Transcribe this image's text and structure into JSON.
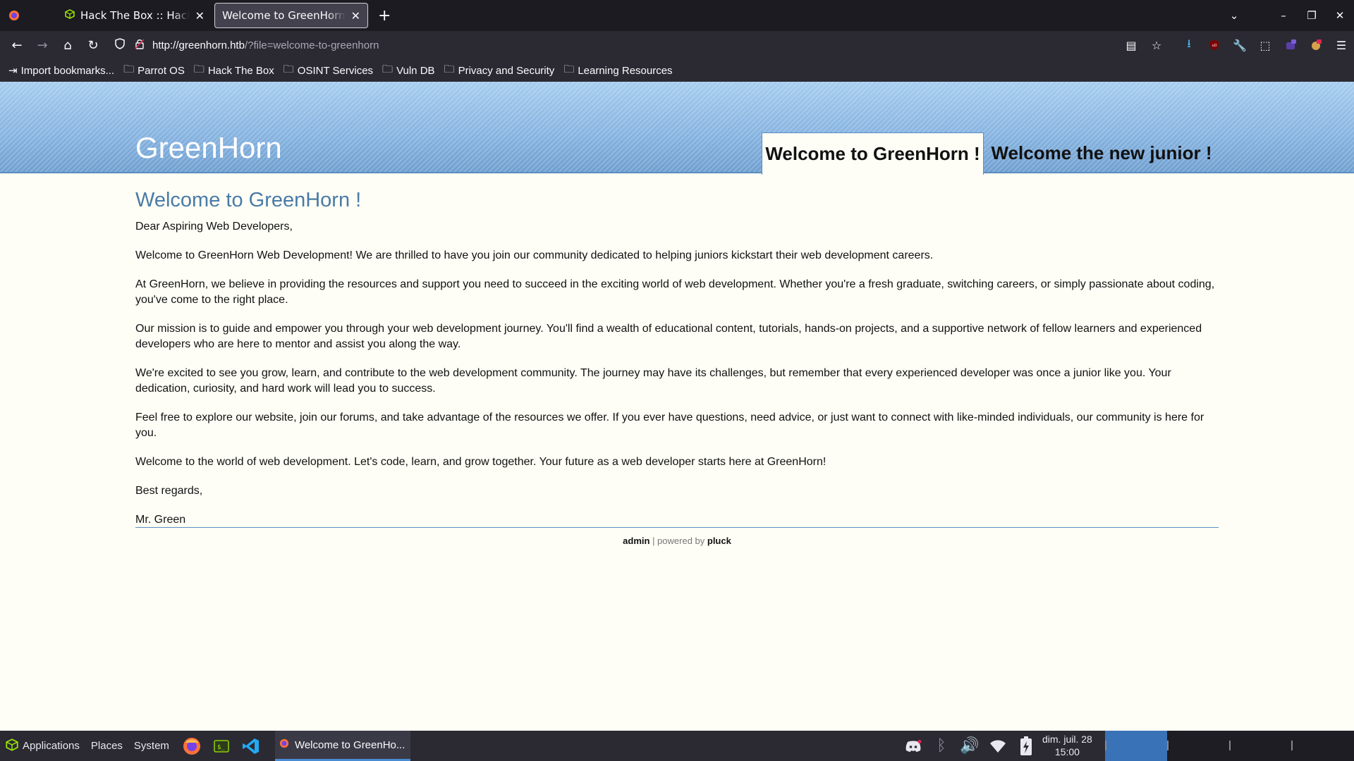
{
  "browser": {
    "tabs": [
      {
        "title": "Hack The Box :: Hack The Box",
        "active": false,
        "icon": "htb-cube-icon"
      },
      {
        "title": "Welcome to GreenHorn ! - GreenHorn",
        "active": true,
        "icon": null
      }
    ],
    "new_tab_label": "+",
    "url_host": "http://greenhorn.htb",
    "url_path": "/?file=welcome-to-greenhorn",
    "bookmarks": [
      {
        "label": "Import bookmarks...",
        "icon": "import-icon"
      },
      {
        "label": "Parrot OS",
        "icon": "folder-icon"
      },
      {
        "label": "Hack The Box",
        "icon": "folder-icon"
      },
      {
        "label": "OSINT Services",
        "icon": "folder-icon"
      },
      {
        "label": "Vuln DB",
        "icon": "folder-icon"
      },
      {
        "label": "Privacy and Security",
        "icon": "folder-icon"
      },
      {
        "label": "Learning Resources",
        "icon": "folder-icon"
      }
    ]
  },
  "site": {
    "title": "GreenHorn",
    "menu": [
      "Welcome to GreenHorn !",
      "Welcome the new junior !"
    ],
    "heading": "Welcome to GreenHorn !",
    "paragraphs": [
      "Dear Aspiring Web Developers,",
      "Welcome to GreenHorn Web Development! We are thrilled to have you join our community dedicated to helping juniors kickstart their web development careers.",
      "At GreenHorn, we believe in providing the resources and support you need to succeed in the exciting world of web development. Whether you're a fresh graduate, switching careers, or simply passionate about coding, you've come to the right place.",
      "Our mission is to guide and empower you through your web development journey. You'll find a wealth of educational content, tutorials, hands-on projects, and a supportive network of fellow learners and experienced developers who are here to mentor and assist you along the way.",
      "We're excited to see you grow, learn, and contribute to the web development community. The journey may have its challenges, but remember that every experienced developer was once a junior like you. Your dedication, curiosity, and hard work will lead you to success.",
      "Feel free to explore our website, join our forums, and take advantage of the resources we offer. If you ever have questions, need advice, or just want to connect with like-minded individuals, our community is here for you.",
      "Welcome to the world of web development. Let's code, learn, and grow together. Your future as a web developer starts here at GreenHorn!",
      "Best regards,",
      "Mr. Green"
    ],
    "footer": {
      "admin": "admin",
      "separator": " | powered by ",
      "pluck": "pluck"
    }
  },
  "taskbar": {
    "menus": [
      "Applications",
      "Places",
      "System"
    ],
    "window_title": "Welcome to GreenHo...",
    "clock_date": "dim. juil. 28",
    "clock_time": "15:00",
    "tray_icons": [
      "discord-icon",
      "bluetooth-icon",
      "volume-icon",
      "wifi-icon",
      "battery-icon"
    ]
  }
}
